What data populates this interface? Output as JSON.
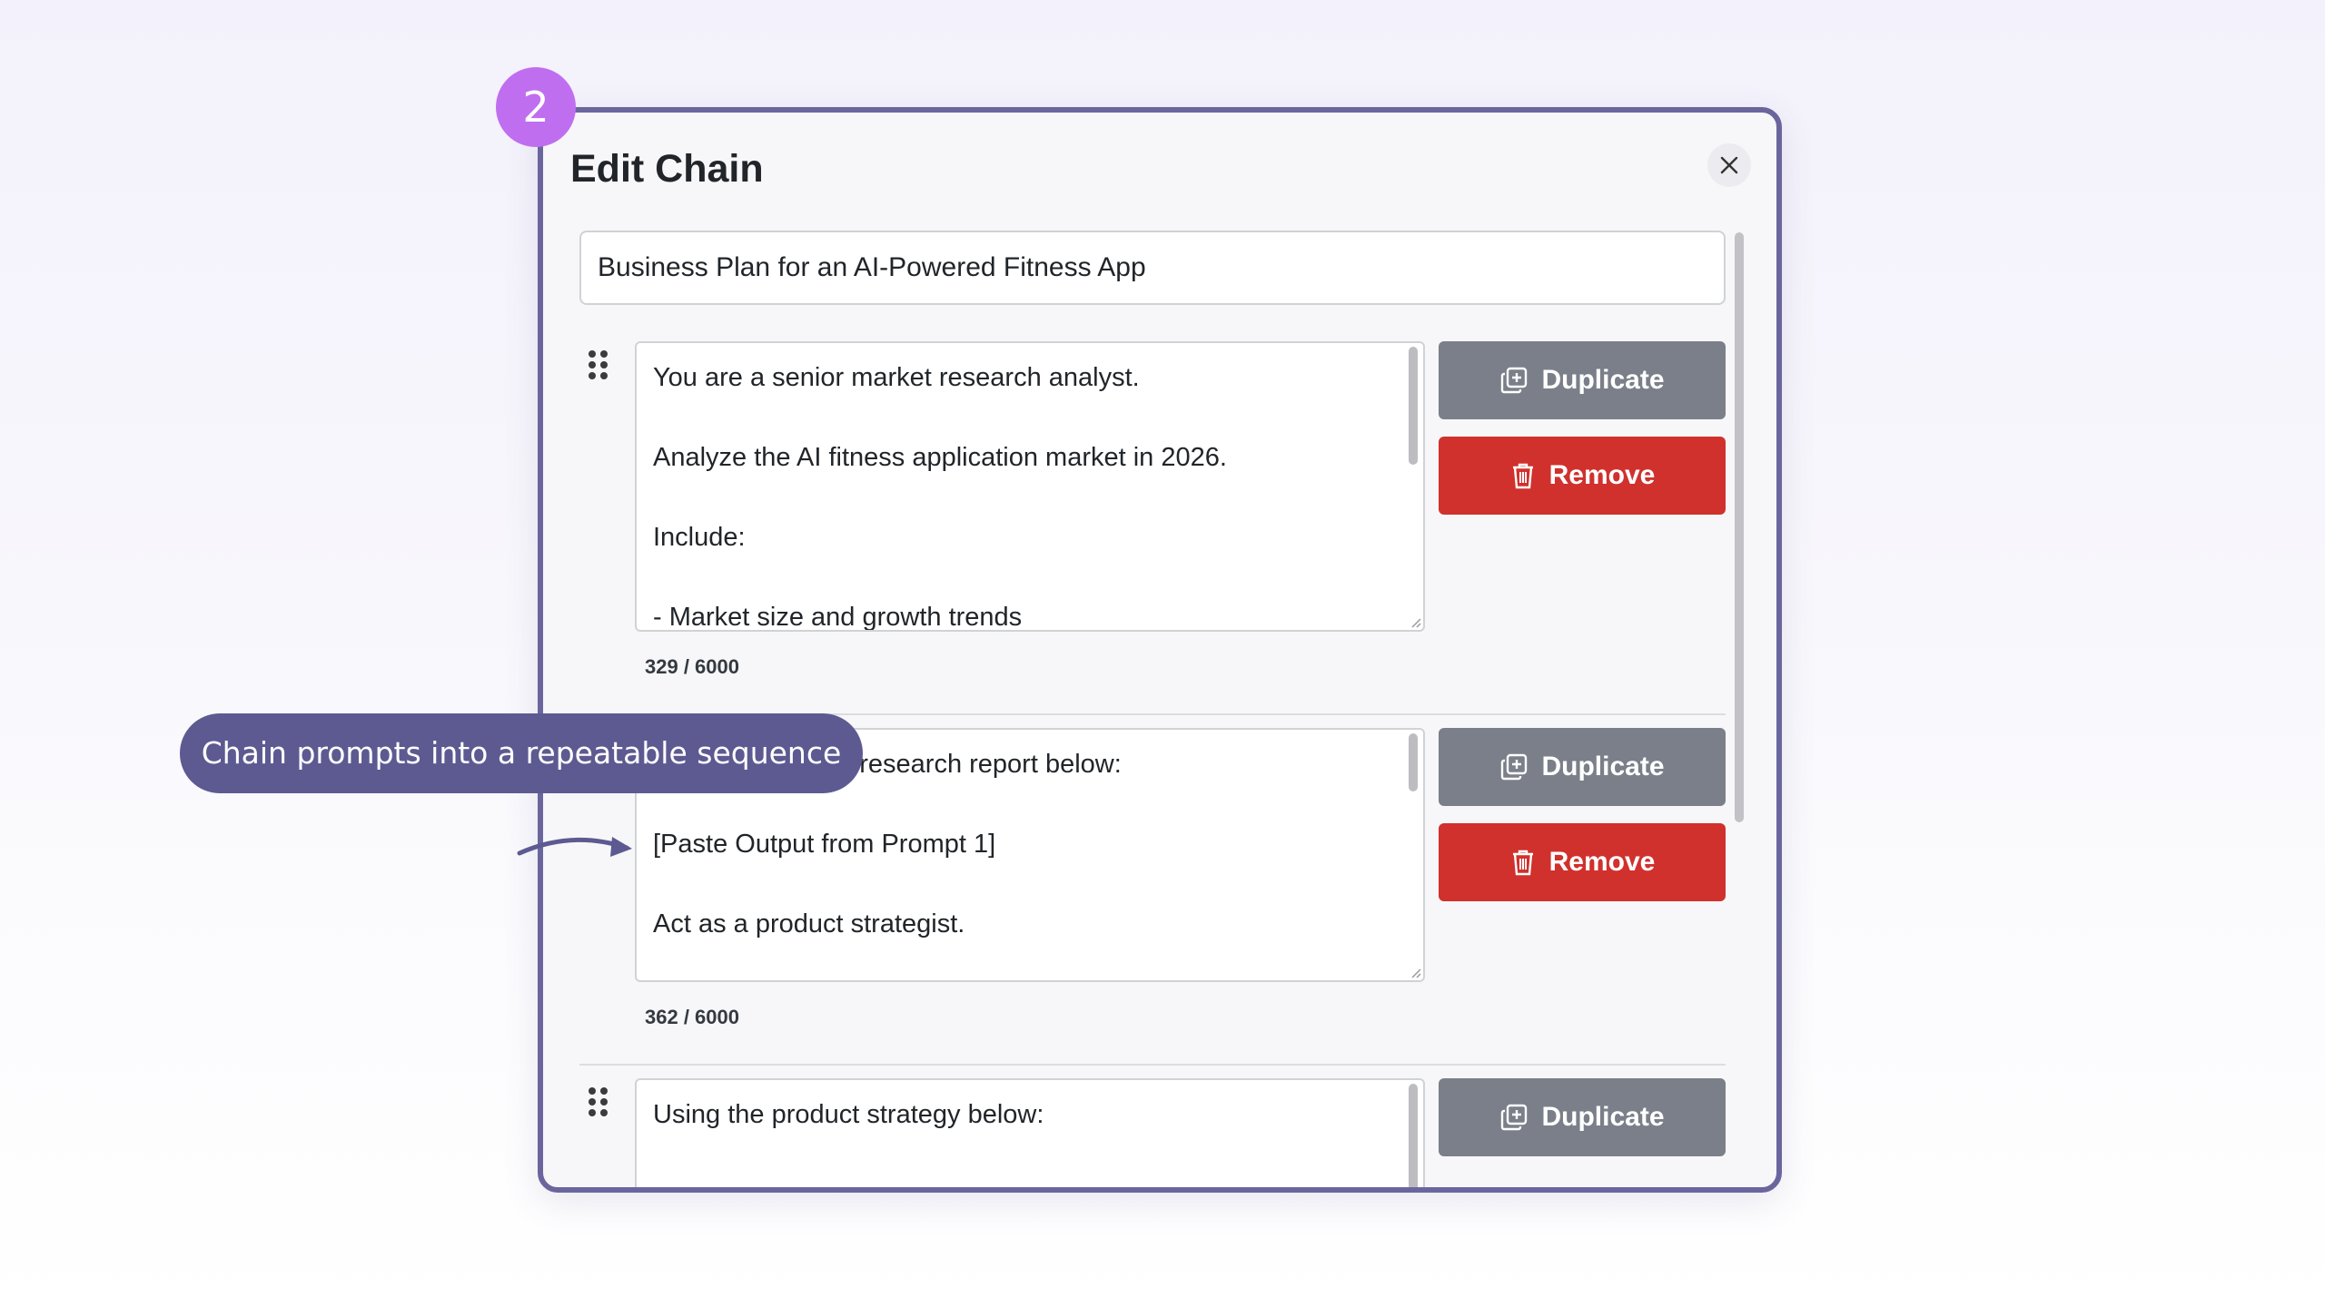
{
  "step_badge": "2",
  "modal": {
    "title": "Edit Chain",
    "close_icon": "close-icon"
  },
  "chain_name": {
    "value": "Business Plan for an AI-Powered Fitness App"
  },
  "steps": [
    {
      "text": "You are a senior market research analyst.\n\nAnalyze the AI fitness application market in 2026.\n\nInclude:\n\n- Market size and growth trends",
      "counter": "329 / 6000",
      "duplicate_label": "Duplicate",
      "remove_label": "Remove"
    },
    {
      "text": "Using the market research report below:\n\n[Paste Output from Prompt 1]\n\nAct as a product strategist.",
      "counter": "362 / 6000",
      "duplicate_label": "Duplicate",
      "remove_label": "Remove"
    },
    {
      "text": "Using the product strategy below:",
      "duplicate_label": "Duplicate"
    }
  ],
  "callout": "Chain prompts into a repeatable sequence",
  "colors": {
    "modal_border": "#6a669d",
    "badge": "#c06ef0",
    "callout": "#5d5a91",
    "duplicate_button": "#7a7f89",
    "remove_button": "#d0312d"
  },
  "icons": {
    "duplicate": "duplicate-icon",
    "remove": "trash-icon",
    "drag": "drag-handle-icon"
  }
}
